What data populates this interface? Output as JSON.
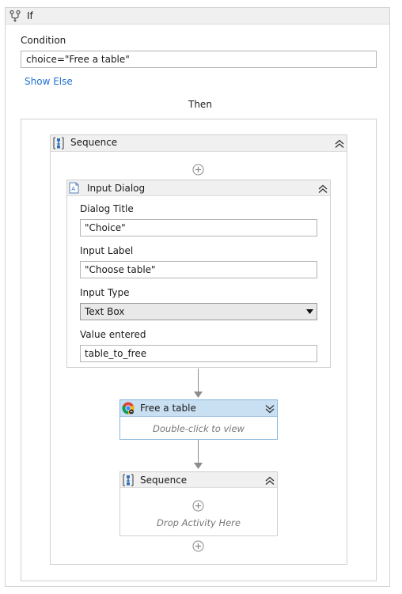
{
  "if_activity": {
    "title": "If",
    "condition_label": "Condition",
    "condition_value": "choice=\"Free a table\"",
    "show_else_link": "Show Else",
    "then_label": "Then"
  },
  "outer_sequence": {
    "title": "Sequence"
  },
  "input_dialog": {
    "title": "Input Dialog",
    "dialog_title_label": "Dialog Title",
    "dialog_title_value": "\"Choice\"",
    "input_label_label": "Input Label",
    "input_label_value": "\"Choose table\"",
    "input_type_label": "Input Type",
    "input_type_selected": "Text Box",
    "value_entered_label": "Value entered",
    "value_entered_value": "table_to_free"
  },
  "free_a_table": {
    "title": "Free a table",
    "hint": "Double-click to view"
  },
  "inner_sequence": {
    "title": "Sequence",
    "hint": "Drop Activity Here"
  },
  "icons": {
    "if": "if-branch-icon",
    "sequence": "sequence-icon",
    "input_dialog": "input-dialog-icon",
    "free_a_table": "chrome-browser-icon",
    "collapse": "double-chevron-up-icon",
    "expand": "double-chevron-down-icon",
    "add": "add-circle-icon",
    "dropdown": "dropdown-arrow-icon"
  },
  "colors": {
    "link": "#1f6fd1",
    "header_bg": "#f0f0f0",
    "selected_header_bg": "#c9dff2",
    "selected_border": "#86b7df",
    "sequence_icon_blue": "#2a6fbf"
  }
}
